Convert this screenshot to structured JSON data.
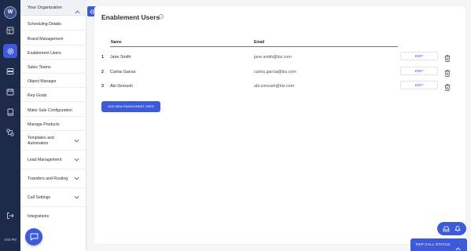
{
  "rail": {
    "logo_text": "W",
    "icons": [
      "table-icon",
      "gear-icon",
      "server-icon",
      "calendar-icon",
      "book-icon",
      "routing-icon",
      "logout-icon"
    ],
    "active_icon": "gear-icon",
    "time": "3:03 PM"
  },
  "sidebar": {
    "header": "Your Organization",
    "items": [
      {
        "label": "Scheduling Details",
        "expandable": false
      },
      {
        "label": "Brand Management",
        "expandable": false
      },
      {
        "label": "Enablement Users",
        "expandable": false
      },
      {
        "label": "Sales Teams",
        "expandable": false
      },
      {
        "label": "Object Manager",
        "expandable": false
      },
      {
        "label": "Rep Goals",
        "expandable": false
      },
      {
        "label": "Make Sale Configuration",
        "expandable": false
      },
      {
        "label": "Manage Products",
        "expandable": false
      },
      {
        "label": "Templates and Automation",
        "expandable": true
      },
      {
        "label": "Lead Management",
        "expandable": true
      },
      {
        "label": "Transfers and Routing",
        "expandable": true
      },
      {
        "label": "Call Settings",
        "expandable": true
      },
      {
        "label": "Integrations",
        "expandable": false
      }
    ]
  },
  "main": {
    "title": "Enablement Users",
    "columns": {
      "name": "Name",
      "email": "Email"
    },
    "rows": [
      {
        "num": "1",
        "name": "Jane Smith",
        "email": "jane.smith@biz.com",
        "edit": "EDIT"
      },
      {
        "num": "2",
        "name": "Carlos Garcia",
        "email": "carlos.garcia@biz.com",
        "edit": "EDIT"
      },
      {
        "num": "3",
        "name": "Abi Soroush",
        "email": "abi.soroush@biz.com",
        "edit": "EDIT"
      }
    ],
    "add_button": "ADD NEW ENABLEMENT USER"
  },
  "footer": {
    "rep_call_status": "REP CALL STATUS"
  },
  "colors": {
    "accent": "#3d5bd9",
    "rail": "#1e2a4a"
  }
}
